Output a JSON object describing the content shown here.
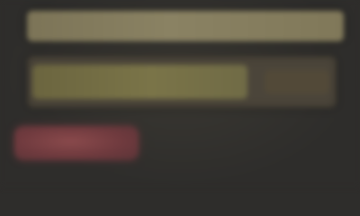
{
  "colors": {
    "background": "#2e2d2b",
    "top_bar": "#857d5e",
    "panel": "#4b453a",
    "progress_fill": "#746e44",
    "button": "#7a4044"
  },
  "progress": {
    "fraction": 0.72
  }
}
